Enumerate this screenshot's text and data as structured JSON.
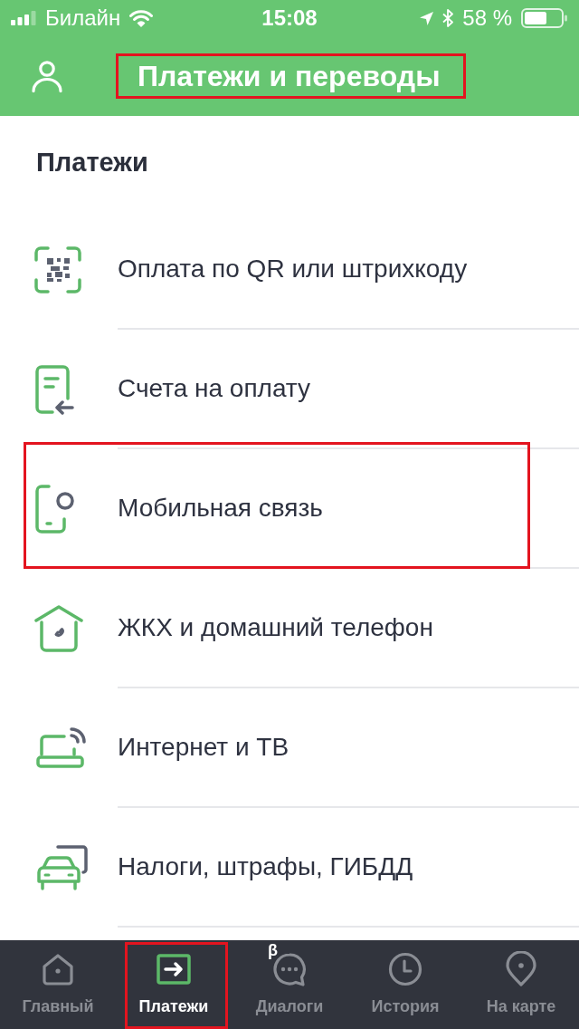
{
  "status_bar": {
    "carrier": "Билайн",
    "time": "15:08",
    "battery": "58 %"
  },
  "header": {
    "title": "Платежи и переводы",
    "highlighted": true
  },
  "section": {
    "title": "Платежи"
  },
  "items": [
    {
      "label": "Оплата по QR или штрихкоду",
      "kind": "qr",
      "highlighted": false
    },
    {
      "label": "Счета на оплату",
      "kind": "invoice",
      "highlighted": false
    },
    {
      "label": "Мобильная связь",
      "kind": "phone",
      "highlighted": true
    },
    {
      "label": "ЖКХ и домашний телефон",
      "kind": "house",
      "highlighted": false
    },
    {
      "label": "Интернет и ТВ",
      "kind": "router",
      "highlighted": false
    },
    {
      "label": "Налоги, штрафы, ГИБДД",
      "kind": "car",
      "highlighted": false
    }
  ],
  "tabs": [
    {
      "label": "Главный",
      "kind": "home",
      "selected": false,
      "highlighted": false
    },
    {
      "label": "Платежи",
      "kind": "payments",
      "selected": true,
      "highlighted": true
    },
    {
      "label": "Диалоги",
      "kind": "chat",
      "badge": "β",
      "selected": false,
      "highlighted": false
    },
    {
      "label": "История",
      "kind": "history",
      "selected": false,
      "highlighted": false
    },
    {
      "label": "На карте",
      "kind": "map",
      "selected": false,
      "highlighted": false
    }
  ]
}
